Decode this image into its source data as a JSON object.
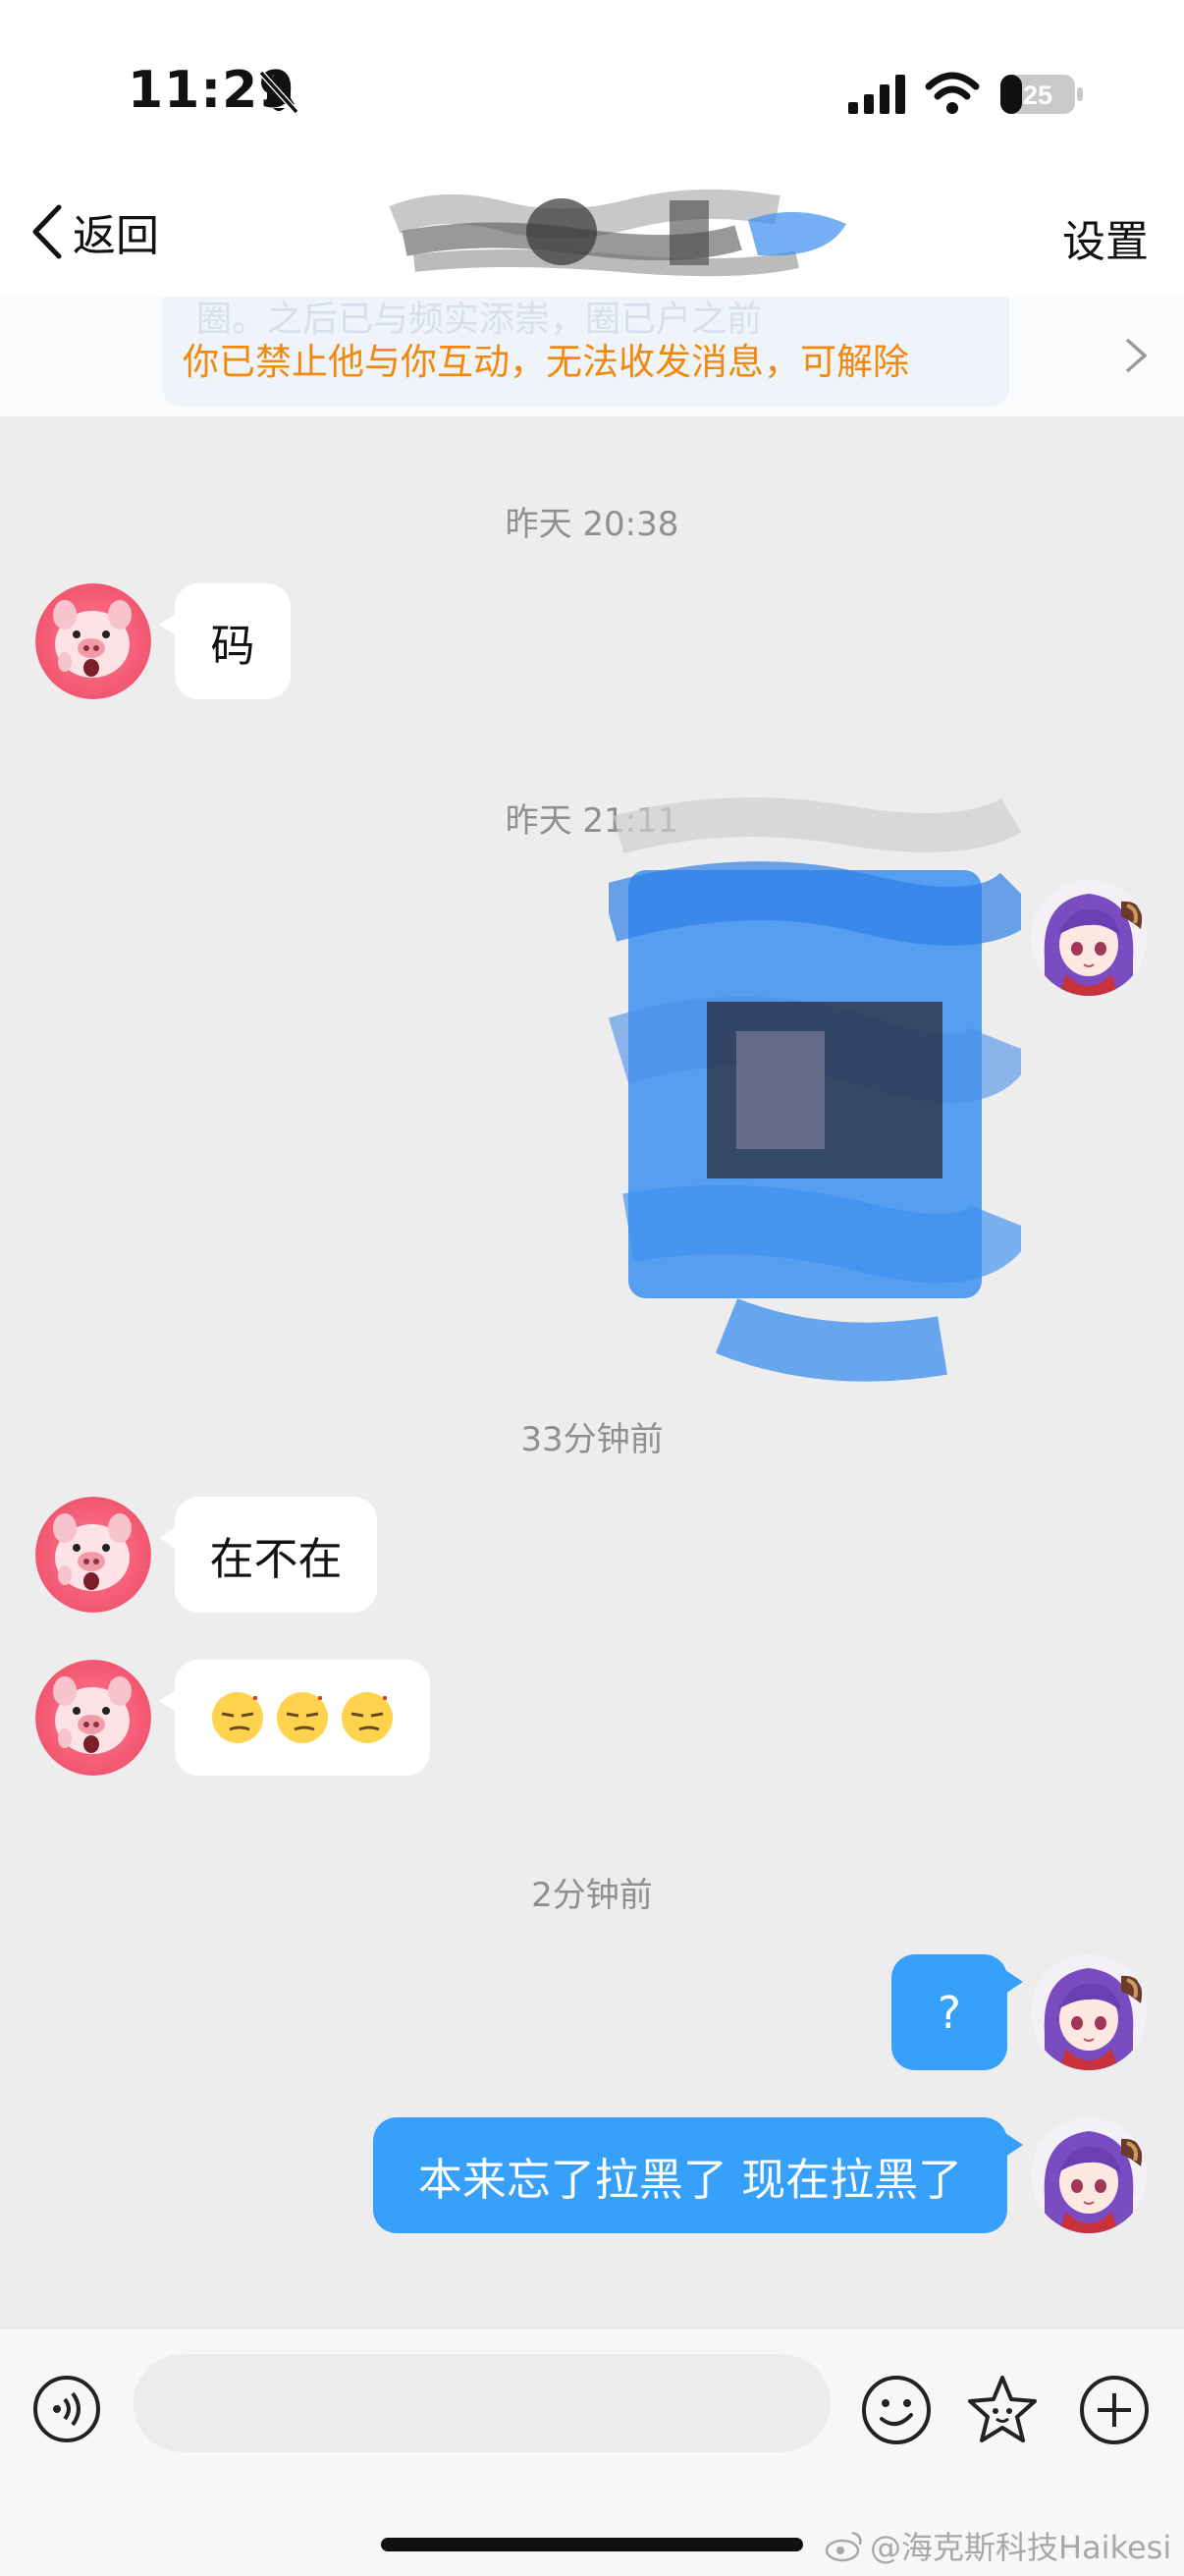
{
  "status_bar": {
    "time": "11:29",
    "battery": "25"
  },
  "nav": {
    "back_label": "返回",
    "settings_label": "设置"
  },
  "banner": {
    "ghost_text": "圈。之后已与频实添崇，圈已户之前",
    "text": "你已禁止他与你互动，无法收发消息，可解除"
  },
  "messages": [
    {
      "type": "timestamp",
      "text": "昨天 20:38"
    },
    {
      "type": "incoming",
      "text": "码"
    },
    {
      "type": "timestamp",
      "text": "昨天 21:11"
    },
    {
      "type": "timestamp",
      "text": "33分钟前"
    },
    {
      "type": "incoming",
      "text": "在不在"
    },
    {
      "type": "incoming",
      "text": ""
    },
    {
      "type": "timestamp",
      "text": "2分钟前"
    },
    {
      "type": "outgoing",
      "text": "?"
    },
    {
      "type": "outgoing",
      "text": "本来忘了拉黑了 现在拉黑了"
    }
  ],
  "watermark": "@海克斯科技Haikesi",
  "colors": {
    "accent_blue": "#37a0fb",
    "warning_orange": "#f2880d",
    "chat_bg": "#ededed"
  },
  "icons": [
    "bell-slash-icon",
    "signal-icon",
    "wifi-icon",
    "battery-icon",
    "chevron-left-icon",
    "chevron-right-icon",
    "voice-icon",
    "emoji-icon",
    "star-icon",
    "plus-icon",
    "weibo-icon"
  ]
}
